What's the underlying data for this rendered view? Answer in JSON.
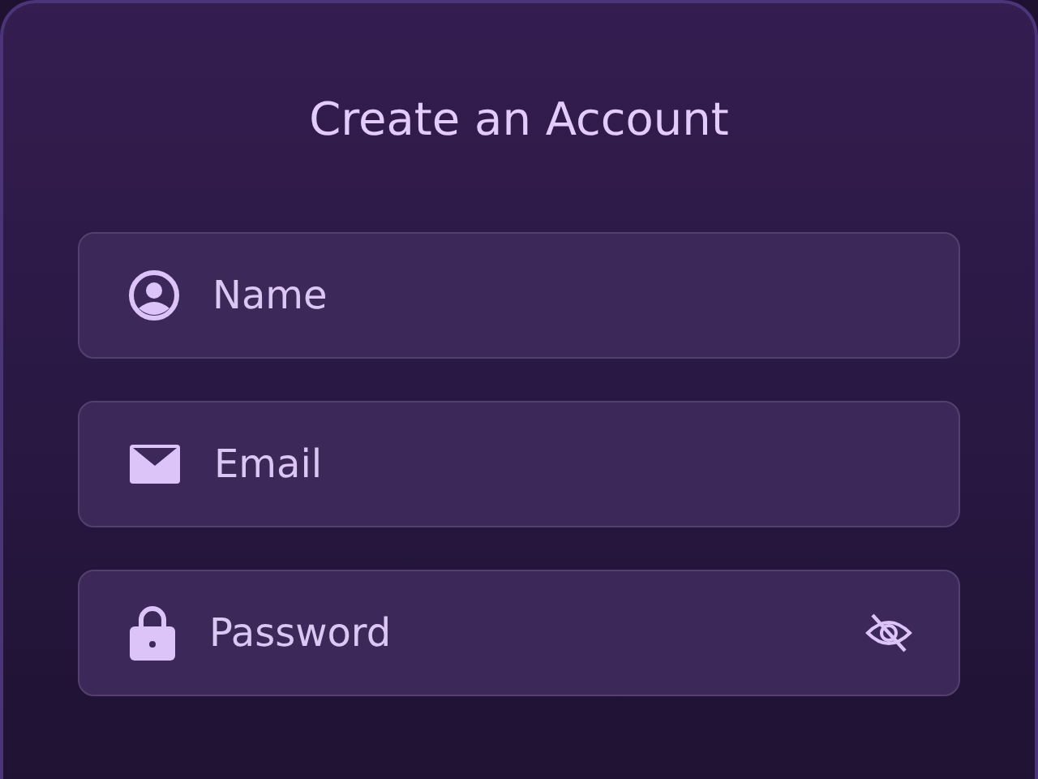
{
  "title": "Create an Account",
  "fields": [
    {
      "kind": "name",
      "placeholder": "Name"
    },
    {
      "kind": "email",
      "placeholder": "Email"
    },
    {
      "kind": "password",
      "placeholder": "Password"
    }
  ]
}
